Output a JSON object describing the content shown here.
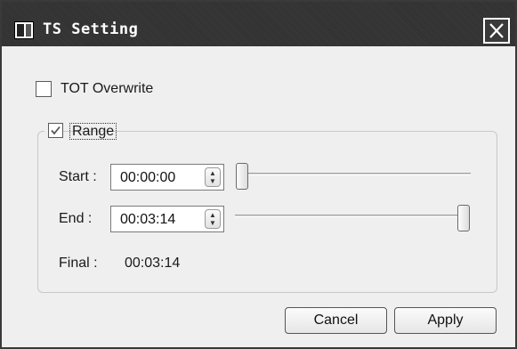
{
  "window": {
    "title": "TS Setting"
  },
  "tot_overwrite": {
    "label": "TOT Overwrite",
    "checked": false
  },
  "range": {
    "label": "Range",
    "checked": true,
    "start": {
      "label": "Start :",
      "value": "00:00:00",
      "slider_fraction": 0.0
    },
    "end": {
      "label": "End :",
      "value": "00:03:14",
      "slider_fraction": 1.0
    },
    "final": {
      "label": "Final :",
      "value": "00:03:14"
    }
  },
  "buttons": {
    "cancel": "Cancel",
    "apply": "Apply"
  }
}
